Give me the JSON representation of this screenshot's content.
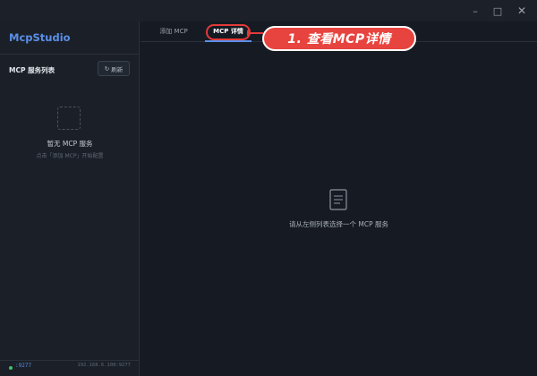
{
  "window": {
    "minimize_glyph": "–",
    "maximize_glyph": "□",
    "close_glyph": "✕"
  },
  "sidebar": {
    "brand": "McpStudio",
    "list_title": "MCP 服务列表",
    "refresh_icon": "↻",
    "refresh_label": "刷新",
    "empty_title": "暂无 MCP 服务",
    "empty_hint": "点击「添加 MCP」开始配置",
    "status_color": "#3fc26a",
    "port": ":9277",
    "address": "192.168.6.108:9277"
  },
  "tabs": [
    {
      "label": "添加 MCP",
      "active": false
    },
    {
      "label": "MCP 详情",
      "active": true
    }
  ],
  "annotation": {
    "text": "1. 查看MCP详情",
    "color": "#e8443f"
  },
  "main": {
    "icon": "document-icon",
    "empty_text": "请从左侧列表选择一个 MCP 服务"
  },
  "colors": {
    "accent": "#5b8fe8",
    "background": "#161b23",
    "sidebar": "#1b2028"
  }
}
